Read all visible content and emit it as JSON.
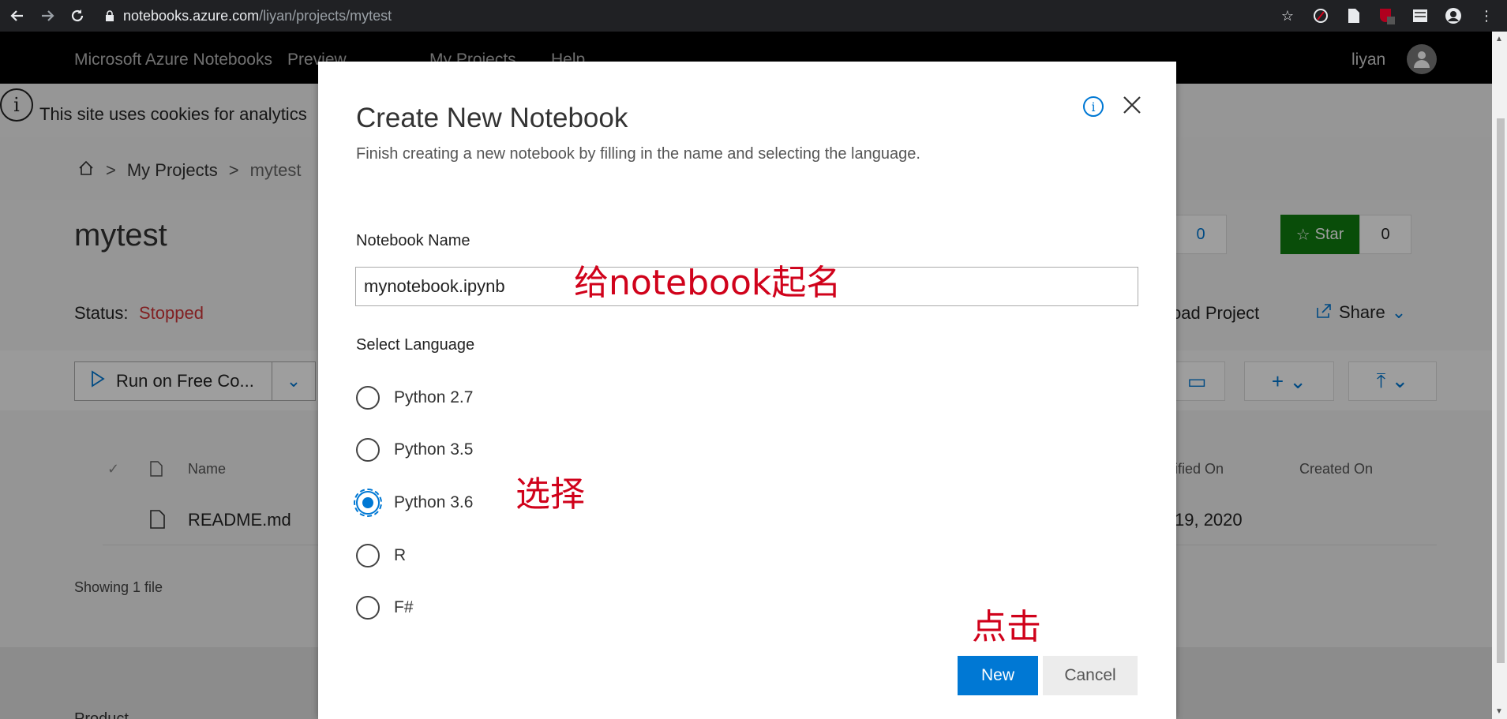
{
  "browser": {
    "url_host": "notebooks.azure.com",
    "url_path": "/liyan/projects/mytest",
    "back_icon": "arrow-left-icon",
    "forward_icon": "arrow-right-icon",
    "reload_icon": "reload-icon"
  },
  "header": {
    "app_title": "Microsoft Azure Notebooks",
    "preview": "Preview",
    "nav_projects": "My Projects",
    "nav_help": "Help",
    "user": "liyan"
  },
  "cookie": {
    "icon": "i",
    "text": "This site uses cookies for analytics"
  },
  "breadcrumb": {
    "sep": ">",
    "projects": "My Projects",
    "current": "mytest"
  },
  "project": {
    "title": "mytest",
    "status_label": "Status:",
    "status_value": "Stopped",
    "clone_count": "0",
    "star_label": "Star",
    "star_count": "0",
    "download_label": "oad Project",
    "share_label": "Share"
  },
  "toolbar": {
    "run_label": "Run on Free Co..."
  },
  "files": {
    "col_name": "Name",
    "col_modified": "ified On",
    "col_created": "Created On",
    "rows": [
      {
        "name": "README.md",
        "modified": "19, 2020"
      }
    ],
    "showing": "Showing 1 file"
  },
  "footer": {
    "text": "Product"
  },
  "modal": {
    "title": "Create New Notebook",
    "subtitle": "Finish creating a new notebook by filling in the name and selecting the language.",
    "info_icon_text": "i",
    "name_label": "Notebook Name",
    "name_value": "mynotebook.ipynb",
    "language_label": "Select Language",
    "languages": [
      {
        "label": "Python 2.7",
        "selected": false
      },
      {
        "label": "Python 3.5",
        "selected": false
      },
      {
        "label": "Python 3.6",
        "selected": true
      },
      {
        "label": "R",
        "selected": false
      },
      {
        "label": "F#",
        "selected": false
      }
    ],
    "new_label": "New",
    "cancel_label": "Cancel"
  },
  "annotations": {
    "name_hint": "给notebook起名",
    "select_hint": "选择",
    "click_hint": "点击"
  },
  "colors": {
    "accent": "#0078d4",
    "status_stopped": "#d13438",
    "star_green": "#107c10",
    "annotation_red": "#d0021b"
  }
}
